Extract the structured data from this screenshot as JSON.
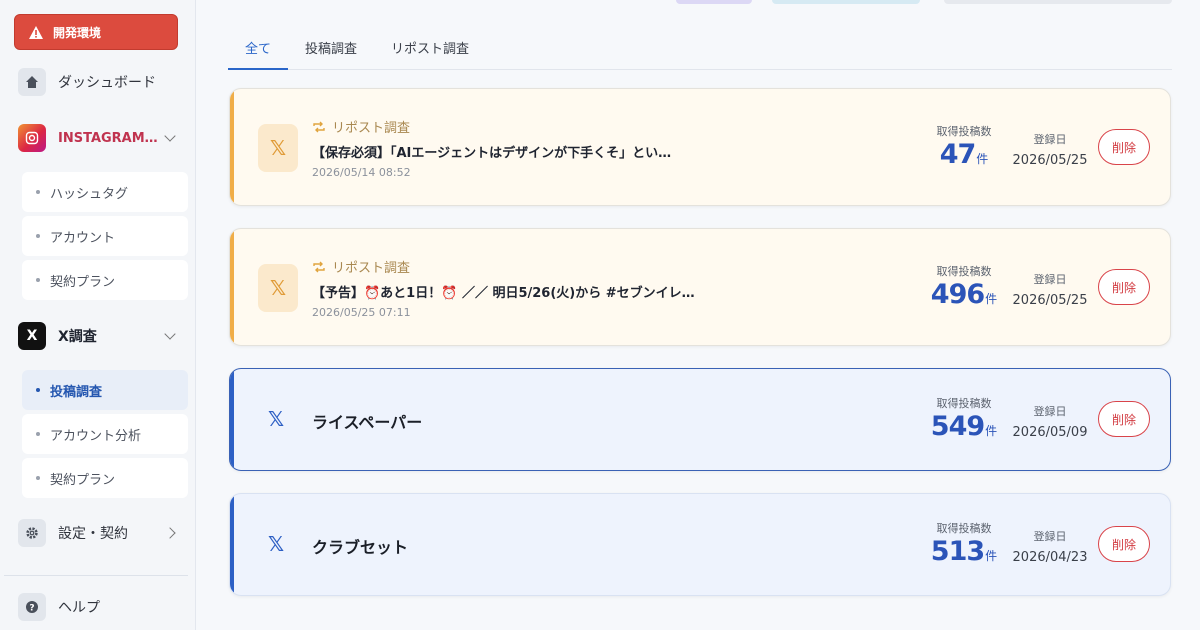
{
  "sidebar": {
    "env_badge": "開発環境",
    "dashboard": "ダッシュボード",
    "instagram": {
      "label": "INSTAGRAM…",
      "items": [
        {
          "label": "ハッシュタグ"
        },
        {
          "label": "アカウント"
        },
        {
          "label": "契約プラン"
        }
      ]
    },
    "x_research": {
      "label": "X調査",
      "items": [
        {
          "label": "投稿調査",
          "active": true
        },
        {
          "label": "アカウント分析"
        },
        {
          "label": "契約プラン"
        }
      ]
    },
    "settings": "設定・契約",
    "help": "ヘルプ"
  },
  "tabs": [
    {
      "label": "全て",
      "active": true
    },
    {
      "label": "投稿調査"
    },
    {
      "label": "リポスト調査"
    }
  ],
  "labels": {
    "count_label": "取得投稿数",
    "count_unit": "件",
    "registered_label": "登録日",
    "delete_button": "削除"
  },
  "cards": [
    {
      "kind": "repost",
      "type_label": "リポスト調査",
      "title": "【保存必須】「AIエージェントはデザインが下手くそ」とい…",
      "date": "2026/05/14 08:52",
      "count": "47",
      "registered": "2026/05/25"
    },
    {
      "kind": "repost",
      "type_label": "リポスト調査",
      "title": "【予告】⏰あと1日！⏰ ／／ 明日5/26(火)から #セブンイレ…",
      "date": "2026/05/25 07:11",
      "count": "496",
      "registered": "2026/05/25"
    },
    {
      "kind": "account",
      "name": "ライスペーパー",
      "count": "549",
      "registered": "2026/05/09"
    },
    {
      "kind": "account",
      "name": "クラブセット",
      "count": "513",
      "registered": "2026/04/23"
    }
  ],
  "colors": {
    "accent": "#2a66c9",
    "danger": "#d9444a",
    "repost_bar": "#f0ad47",
    "account_bar": "#2c5fc5"
  }
}
